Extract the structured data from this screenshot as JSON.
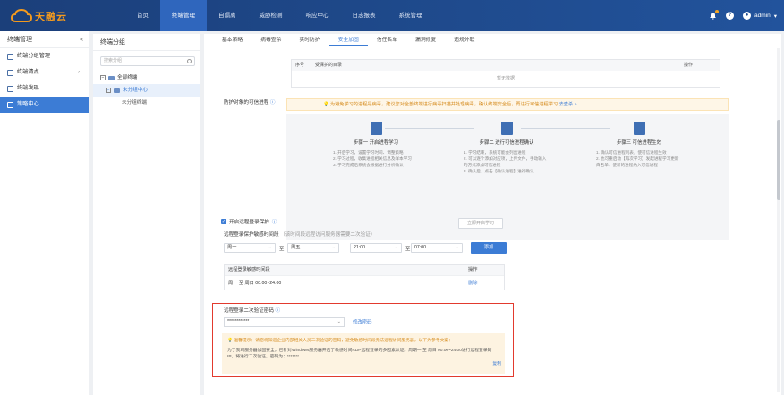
{
  "app": {
    "logo_text": "天融云",
    "logo_sub": "TOPSEC CLOUD",
    "nav": [
      "首页",
      "终端管理",
      "自隔离",
      "威胁检测",
      "响应中心",
      "日志报表",
      "系统管理"
    ],
    "user": "admin"
  },
  "sidebar": {
    "title": "终端管理",
    "collapse": "«",
    "items": [
      {
        "label": "终端分组管理"
      },
      {
        "label": "终端清点",
        "arrow": "›"
      },
      {
        "label": "终端发现"
      },
      {
        "label": "策略中心"
      }
    ]
  },
  "group": {
    "title": "终端分组",
    "search_placeholder": "搜索分组",
    "tree": {
      "root": "全部终端",
      "child": "未分组中心",
      "leaf": "未分组终端"
    }
  },
  "tabs": [
    "基本策略",
    "病毒查杀",
    "实时防护",
    "安全加固",
    "信任名单",
    "漏洞修复",
    "违规外联"
  ],
  "protected_table": {
    "headers": [
      "序号",
      "受保护的目录",
      "操作"
    ],
    "empty": "暂无数据"
  },
  "trusted_process": {
    "label": "防护对象的可信进程",
    "notice": "为避免学习的进程是病毒，建议您对全部终端进行病毒扫描并处理病毒，确认终端安全后，再进行可信进程学习",
    "notice_link": "去查杀 »",
    "steps": [
      {
        "title": "步骤一  开启进程学习",
        "desc": "1. 开启学习，设置学习时间、调整策略\n2. 学习过程，收集进程相关信息及样本学习\n3. 学习完成后系统会根据进行分析确认"
      },
      {
        "title": "步骤二  进行可信进程确认",
        "desc": "1. 学习结束，系统可能会列出进程\n2. 可以逐个添加对应项，上传文件，手动输入的方式添加可信进程\n3. 确认后，点击【确认进程】进行确认"
      },
      {
        "title": "步骤三  可信进程生效",
        "desc": "1. 确认可信进程列表，使可信进程生效\n2. 也可重启动【再次学习】发起进程学习更新白名单，使新的进程纳入可信进程"
      }
    ],
    "start_button": "立即开启学习"
  },
  "remote_login": {
    "checkbox_label": "开启远程登录保护",
    "time_label": "远程登录保护敏感时间段",
    "time_hint": "（该时间段远程访问服务器需要二次验证）",
    "from_day": "周一",
    "to_label": "至",
    "to_day": "周五",
    "from_time": "21:00",
    "to_time": "07:00",
    "add_button": "添加",
    "table_headers": [
      "远程登录敏感时间段",
      "操作"
    ],
    "rows": [
      {
        "period": "周一 至 周日 00:00~24:00",
        "action": "删除"
      }
    ]
  },
  "second_verify": {
    "label": "远程登录二次验证密码",
    "password": "************",
    "modify": "修改密码",
    "warn_title": "温馨提示：请您将知道企业内部相关人员二次验证的密码，避免敏感时间段无法远程访问服务器，以下为参考文案：",
    "warn_body": "为了我司服务器加固安全，已针对Windows服务器开启了敏感时间RDP远程登录的多因素认证。周期一 至 周日 00:00~24:00进行远程登录的IP，将进行二次验证，密码为：*******",
    "copy": "复制"
  }
}
